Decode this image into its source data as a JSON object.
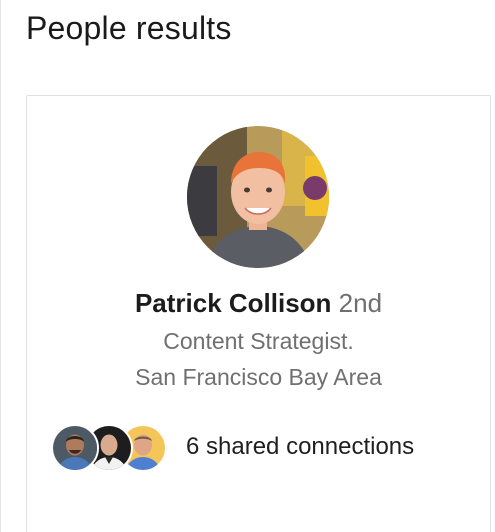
{
  "section": {
    "title": "People results"
  },
  "person": {
    "name": "Patrick Collison",
    "degree": "2nd",
    "headline": "Content Strategist.",
    "location": "San Francisco Bay Area"
  },
  "shared_connections": {
    "label": "6 shared connections"
  },
  "colors": {
    "primary_text": "#1c1c1c",
    "secondary_text": "#707070",
    "card_border": "#e0e0e0"
  }
}
